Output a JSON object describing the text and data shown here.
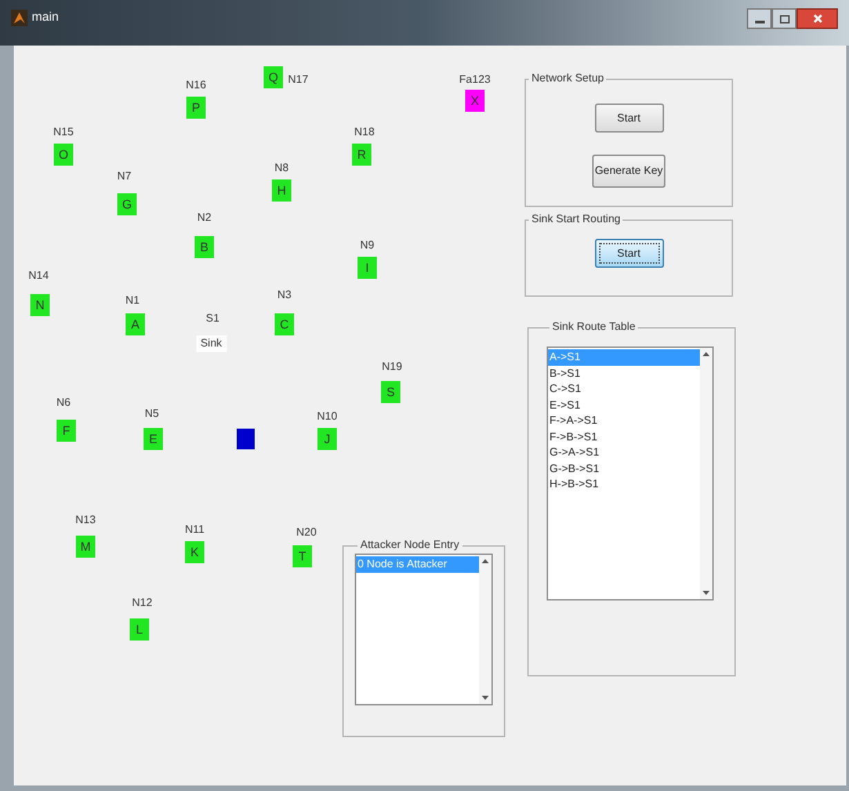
{
  "window": {
    "title": "main"
  },
  "nodes": [
    {
      "kind": "node",
      "name": "N16",
      "letter": "P",
      "color": "#22e622"
    },
    {
      "kind": "node",
      "name": "N17",
      "letter": "Q",
      "color": "#22e622"
    },
    {
      "kind": "node",
      "name": "N15",
      "letter": "O",
      "color": "#22e622"
    },
    {
      "kind": "node",
      "name": "N18",
      "letter": "R",
      "color": "#22e622"
    },
    {
      "kind": "node",
      "name": "N7",
      "letter": "G",
      "color": "#22e622"
    },
    {
      "kind": "node",
      "name": "N8",
      "letter": "H",
      "color": "#22e622"
    },
    {
      "kind": "node",
      "name": "N2",
      "letter": "B",
      "color": "#22e622"
    },
    {
      "kind": "node",
      "name": "N9",
      "letter": "I",
      "color": "#22e622"
    },
    {
      "kind": "node",
      "name": "N14",
      "letter": "N",
      "color": "#22e622"
    },
    {
      "kind": "node",
      "name": "N1",
      "letter": "A",
      "color": "#22e622"
    },
    {
      "kind": "node",
      "name": "N3",
      "letter": "C",
      "color": "#22e622"
    },
    {
      "kind": "sink",
      "name": "S1",
      "letter": "Sink"
    },
    {
      "kind": "node",
      "name": "N19",
      "letter": "S",
      "color": "#22e622"
    },
    {
      "kind": "node",
      "name": "N6",
      "letter": "F",
      "color": "#22e622"
    },
    {
      "kind": "node",
      "name": "N5",
      "letter": "E",
      "color": "#22e622"
    },
    {
      "kind": "marker",
      "color": "#0000cc"
    },
    {
      "kind": "node",
      "name": "N10",
      "letter": "J",
      "color": "#22e622"
    },
    {
      "kind": "node",
      "name": "N13",
      "letter": "M",
      "color": "#22e622"
    },
    {
      "kind": "node",
      "name": "N11",
      "letter": "K",
      "color": "#22e622"
    },
    {
      "kind": "node",
      "name": "N20",
      "letter": "T",
      "color": "#22e622"
    },
    {
      "kind": "node",
      "name": "N12",
      "letter": "L",
      "color": "#22e622"
    },
    {
      "kind": "node",
      "name": "Fa123",
      "letter": "X",
      "color": "#ff00ff"
    }
  ],
  "network_setup": {
    "title": "Network Setup",
    "buttons": [
      {
        "label": "Start",
        "focused": false
      },
      {
        "label": "Generate Key",
        "focused": false
      }
    ]
  },
  "sink_start_routing": {
    "title": "Sink Start Routing",
    "buttons": [
      {
        "label": "Start",
        "focused": true
      }
    ]
  },
  "sink_route_table": {
    "title": "Sink Route Table",
    "items": [
      {
        "text": "A->S1",
        "selected": true
      },
      {
        "text": "B->S1",
        "selected": false
      },
      {
        "text": "C->S1",
        "selected": false
      },
      {
        "text": "E->S1",
        "selected": false
      },
      {
        "text": "F->A->S1",
        "selected": false
      },
      {
        "text": "F->B->S1",
        "selected": false
      },
      {
        "text": "G->A->S1",
        "selected": false
      },
      {
        "text": "G->B->S1",
        "selected": false
      },
      {
        "text": "H->B->S1",
        "selected": false
      }
    ]
  },
  "attacker_node_entry": {
    "title": "Attacker Node Entry",
    "items": [
      {
        "text": "0 Node is Attacker",
        "selected": true
      }
    ]
  }
}
